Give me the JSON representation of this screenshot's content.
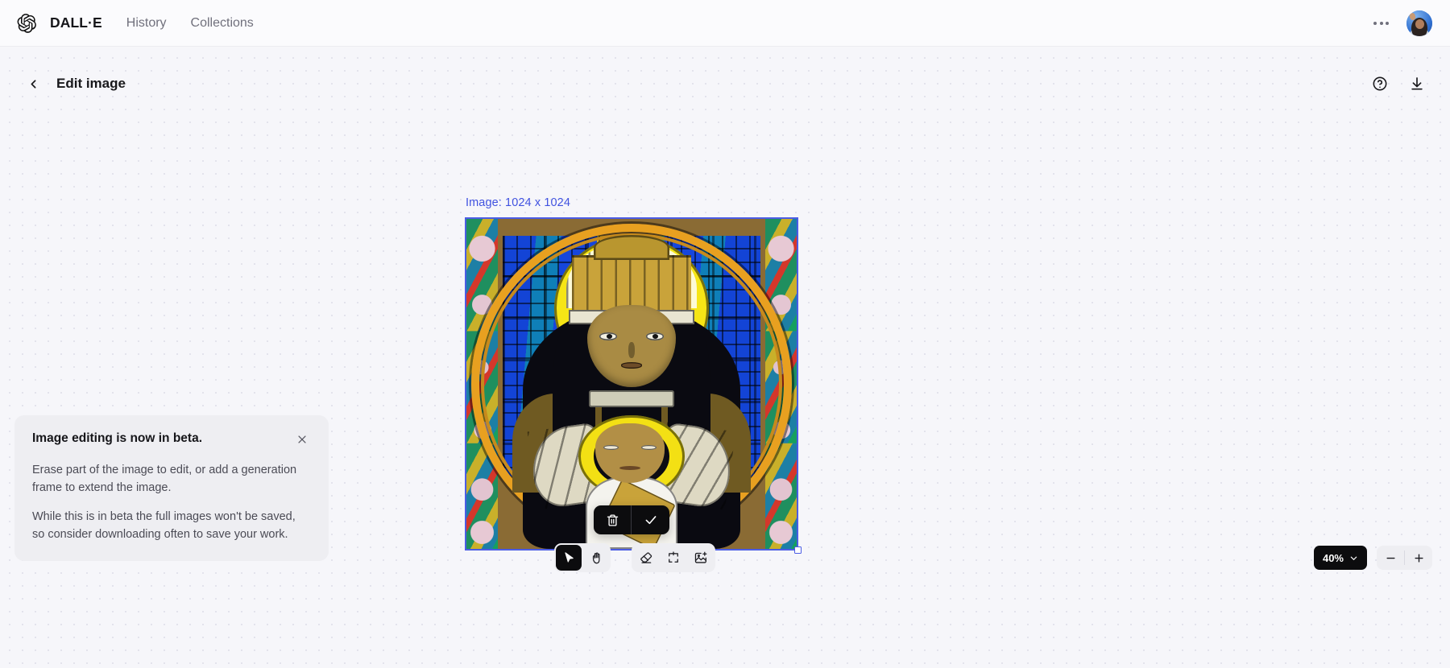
{
  "topbar": {
    "logo_icon": "openai-logo-icon",
    "brand": "DALL·E",
    "nav": [
      {
        "label": "History"
      },
      {
        "label": "Collections"
      }
    ],
    "overflow_icon": "ellipsis-icon",
    "avatar_alt": "user-avatar"
  },
  "editor": {
    "back_icon": "chevron-left-icon",
    "title": "Edit image",
    "help_icon": "help-circle-icon",
    "download_icon": "download-icon"
  },
  "canvas": {
    "image_label": "Image: 1024 x 1024",
    "image_label_color": "#4052e0",
    "selection_border_color": "#4b5ce4",
    "image_subject": "Stained glass window of Madonna and Child",
    "handle": "resize-handle-bottom-right"
  },
  "confirm_bar": {
    "delete_icon": "trash-icon",
    "confirm_icon": "check-icon"
  },
  "toolbar": {
    "tools": [
      {
        "name": "select-tool",
        "icon": "cursor-arrow-icon",
        "active": true
      },
      {
        "name": "pan-tool",
        "icon": "hand-icon",
        "active": false
      },
      {
        "name": "erase-tool",
        "icon": "eraser-icon",
        "active": false
      },
      {
        "name": "generation-frame-tool",
        "icon": "add-frame-icon",
        "active": false
      },
      {
        "name": "add-image-tool",
        "icon": "add-image-icon",
        "active": false
      }
    ]
  },
  "zoom": {
    "level": "40%",
    "chevron_icon": "chevron-down-icon",
    "zoom_out_icon": "minus-icon",
    "zoom_in_icon": "plus-icon"
  },
  "beta_notice": {
    "title": "Image editing is now in beta.",
    "close_icon": "close-icon",
    "paragraphs": [
      "Erase part of the image to edit, or add a generation frame to extend the image.",
      "While this is in beta the full images won't be saved, so consider downloading often to save your work."
    ]
  }
}
